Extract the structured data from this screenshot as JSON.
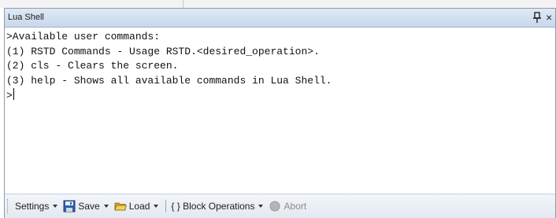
{
  "window": {
    "title": "Lua Shell",
    "close_glyph": "×"
  },
  "console": {
    "lines": [
      ">Available user commands:",
      "(1) RSTD Commands - Usage RSTD.<desired_operation>.",
      "(2) cls - Clears the screen.",
      "(3) help - Shows all available commands in Lua Shell.",
      ">"
    ]
  },
  "toolbar": {
    "settings": "Settings",
    "save": "Save",
    "load": "Load",
    "block_operations": "{ } Block Operations",
    "abort": "Abort"
  },
  "icons": {
    "pin": "pin-icon",
    "close": "close-icon",
    "save": "floppy-disk-icon",
    "load": "open-folder-icon",
    "abort": "stop-circle-icon"
  },
  "colors": {
    "title_bar": "#c7d7ea",
    "toolbar": "#e3e9f1",
    "abort_disabled": "#8a8a8a"
  }
}
